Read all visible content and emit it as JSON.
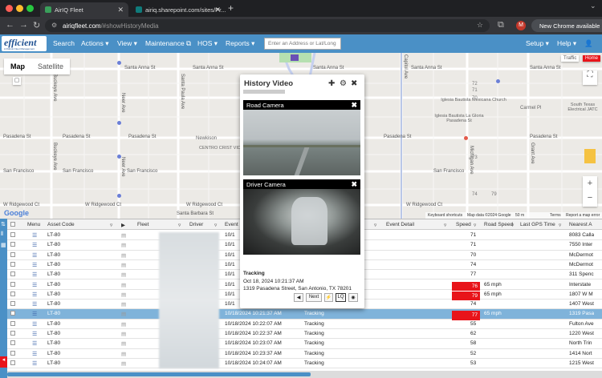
{
  "browser": {
    "tabs": [
      {
        "title": "AirIQ Fleet"
      },
      {
        "title": "airiq.sharepoint.com/sites/Pr..."
      }
    ],
    "url_host": "airiqfleet.com",
    "url_path": "/#showHistoryMedia",
    "update_chip": "New Chrome available",
    "colors": {
      "active_tab": "#35363a",
      "inactive_tab": "#1f2023"
    }
  },
  "app": {
    "logo_text": "efficient",
    "logo_subtext": "A Robust Fleet Management",
    "menu": [
      {
        "label": "Search"
      },
      {
        "label": "Actions"
      },
      {
        "label": "View"
      },
      {
        "label": "Maintenance"
      },
      {
        "label": "HOS"
      },
      {
        "label": "Reports"
      }
    ],
    "address_placeholder": "Enter an Address or Lat/Long",
    "right_menu": [
      {
        "label": "Setup"
      },
      {
        "label": "Help"
      }
    ],
    "accent_color": "#4a90c6"
  },
  "map": {
    "map_type_buttons": [
      "Map",
      "Satellite"
    ],
    "street_labels": [
      "Santa Anna St",
      "Santa Anna St",
      "Santa Anna St",
      "Santa Anna St",
      "Santa Anna St",
      "Pasadena St",
      "Pasadena St",
      "Pasadena St",
      "Pasadena St",
      "Pasadena St",
      "San Francisco",
      "San Francisco",
      "San Francisco",
      "San Francisco",
      "W Ridgewood Ct",
      "W Ridgewood Ct",
      "W Ridgewood Ct",
      "W Ridgewood Ct",
      "Santa Barbara St",
      "Buckeye Ave",
      "Buckeye Ave",
      "Neer Ave",
      "Neer Ave",
      "Santa Paula Ave",
      "Capitol Ave",
      "Michigan Ave",
      "Grant Ave"
    ],
    "places": [
      "Newkison",
      "CENTRO CRIST VIDA ETE",
      "Iglesia Bautista Mexicana Church",
      "Iglesia Bautista La Gloria Pasadena St",
      "Carmel Pl",
      "South Texas Electrical JATC"
    ],
    "grid_numbers": [
      "72",
      "71",
      "70",
      "73",
      "74",
      "79"
    ],
    "traffic_btn": "Traffic",
    "home_btn": "Home",
    "footer": [
      "Keyboard shortcuts",
      "Map data ©2024 Google",
      "50 m",
      "Terms",
      "Report a map error"
    ],
    "google": "Google"
  },
  "popup": {
    "title": "History Video",
    "road_camera": "Road Camera",
    "driver_camera": "Driver Camera",
    "status": "Tracking",
    "datetime": "Oct 18, 2024 10:21:37 AM",
    "address": "1319 Pasadena Street, San Antonio, TX 78201",
    "next_label": "Next",
    "lq_label": "LQ"
  },
  "grid": {
    "columns": [
      "Menu",
      "Asset Code",
      "Fleet",
      "Driver",
      "Event",
      "Event Detail",
      "Speed",
      "Road Speed",
      "Last GPS Time",
      "Nearest A"
    ],
    "rows": [
      {
        "asset": "LT-80",
        "time": "10/1",
        "event": "",
        "speed": "71",
        "road": "",
        "addr": "8083 Calla",
        "red": false
      },
      {
        "asset": "LT-80",
        "time": "10/1",
        "event": "",
        "speed": "71",
        "road": "",
        "addr": "7550 Inter",
        "red": false
      },
      {
        "asset": "LT-80",
        "time": "10/1",
        "event": "",
        "speed": "70",
        "road": "",
        "addr": "McDermot",
        "red": false
      },
      {
        "asset": "LT-80",
        "time": "10/1",
        "event": "",
        "speed": "74",
        "road": "",
        "addr": "McDermot",
        "red": false
      },
      {
        "asset": "LT-80",
        "time": "10/1",
        "event": "",
        "speed": "77",
        "road": "",
        "addr": "311 Spenc",
        "red": false
      },
      {
        "asset": "LT-80",
        "time": "10/1",
        "event": "",
        "speed": "76",
        "road": "65 mph",
        "addr": "Interstate",
        "red": true
      },
      {
        "asset": "LT-80",
        "time": "10/1",
        "event": "",
        "speed": "79",
        "road": "65 mph",
        "addr": "1807 W M",
        "red": true
      },
      {
        "asset": "LT-80",
        "time": "10/1",
        "event": "",
        "speed": "74",
        "road": "",
        "addr": "1407 West",
        "red": false
      },
      {
        "asset": "LT-80",
        "time": "10/18/2024 10:21:37 AM",
        "event": "Tracking",
        "speed": "77",
        "road": "65 mph",
        "addr": "1319 Pasa",
        "red": true,
        "selected": true
      },
      {
        "asset": "LT-80",
        "time": "10/18/2024 10:22:07 AM",
        "event": "Tracking",
        "speed": "55",
        "road": "",
        "addr": "Fulton Ave",
        "red": false
      },
      {
        "asset": "LT-80",
        "time": "10/18/2024 10:22:37 AM",
        "event": "Tracking",
        "speed": "62",
        "road": "",
        "addr": "1220 West",
        "red": false
      },
      {
        "asset": "LT-80",
        "time": "10/18/2024 10:23:07 AM",
        "event": "Tracking",
        "speed": "58",
        "road": "",
        "addr": "North Trin",
        "red": false
      },
      {
        "asset": "LT-80",
        "time": "10/18/2024 10:23:37 AM",
        "event": "Tracking",
        "speed": "52",
        "road": "",
        "addr": "1414 Nort",
        "red": false
      },
      {
        "asset": "LT-80",
        "time": "10/18/2024 10:24:07 AM",
        "event": "Tracking",
        "speed": "53",
        "road": "",
        "addr": "1215 West",
        "red": false
      }
    ],
    "speed_alert_color": "#e8141a",
    "selected_color": "#7fb3da"
  }
}
